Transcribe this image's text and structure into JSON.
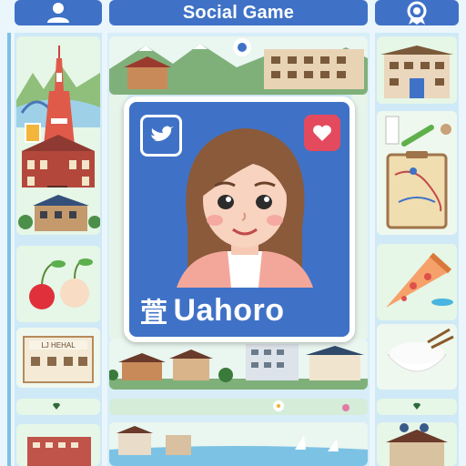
{
  "header": {
    "title": "Social Game",
    "left_icon": "user-icon",
    "right_icon": "settings-icon"
  },
  "profile": {
    "prefix_glyph": "萓",
    "username": "Uahoro",
    "left_icon": "bird-icon",
    "right_icon": "heart-icon"
  },
  "colors": {
    "accent": "#3f72c6",
    "heart": "#e44a5d",
    "card_bg": "#e6f6e7",
    "column_bg": "#cfe9f7"
  },
  "sign_text": "LJ HEHAL"
}
